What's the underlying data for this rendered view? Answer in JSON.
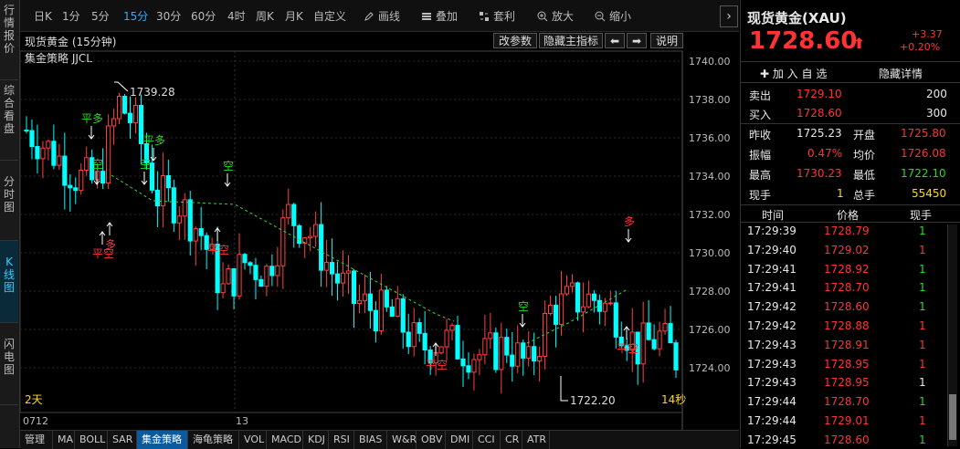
{
  "left_tabs": [
    "行情报价",
    "综合看盘",
    "分时图",
    "K线图",
    "闪电图"
  ],
  "toolbar": {
    "items": [
      "日K",
      "1分",
      "5分",
      "15分",
      "30分",
      "60分",
      "4时",
      "周K",
      "月K",
      "自定义"
    ],
    "active": "15分",
    "draw_label": "画线",
    "overlay_label": "叠加",
    "arbitrage_label": "套利",
    "zoom_in_label": "放大",
    "zoom_out_label": "缩小",
    "collapse_arrow": "›"
  },
  "chart_header": {
    "title": "现货黄金 (15分钟)",
    "strategy": "集金策略 JJCL",
    "btn_params": "改参数",
    "btn_hide": "隐藏主指标",
    "btn_left": "⬅",
    "btn_right": "➡",
    "btn_help": "说明"
  },
  "chart_data": {
    "type": "candlestick",
    "ylim": [
      1721,
      1741
    ],
    "yticks": [
      "1740.00",
      "1738.00",
      "1736.00",
      "1734.00",
      "1732.00",
      "1730.00",
      "1728.00",
      "1726.00",
      "1724.00"
    ],
    "xticks": [
      "0712",
      "13"
    ],
    "bar_count": 120,
    "high_label": "1739.28",
    "low_label": "1722.20",
    "corner_left": "2天",
    "corner_right": "14秒",
    "signals": [
      {
        "text": "平多",
        "type": "green"
      },
      {
        "text": "平多",
        "type": "green"
      },
      {
        "text": "空",
        "type": "green"
      },
      {
        "text": "空",
        "type": "green"
      },
      {
        "text": "空",
        "type": "green"
      },
      {
        "text": "空",
        "type": "green"
      },
      {
        "text": "平空",
        "type": "red"
      },
      {
        "text": "多",
        "type": "red"
      },
      {
        "text": "平空",
        "type": "red"
      },
      {
        "text": "平空",
        "type": "red"
      },
      {
        "text": "多",
        "type": "red"
      },
      {
        "text": "平空",
        "type": "red"
      }
    ]
  },
  "bottom_tabs": [
    "管理",
    "MA",
    "BOLL",
    "SAR",
    "集金策略",
    "海龟策略",
    "VOL",
    "MACD",
    "KDJ",
    "RSI",
    "BIAS",
    "W&R",
    "OBV",
    "DMI",
    "CCI",
    "CR",
    "ATR"
  ],
  "bottom_active": "集金策略",
  "quote": {
    "name": "现货黄金(XAU)",
    "price": "1728.60",
    "arrow": "⬆",
    "change": "+3.37",
    "change_pct": "+0.20%",
    "add_fav": "✚ 加 入 自 选",
    "hide_detail": "隐藏详情",
    "sell_label": "卖出",
    "sell_price": "1729.10",
    "sell_vol": "200",
    "buy_label": "买入",
    "buy_price": "1728.60",
    "buy_vol": "300",
    "prev_close_label": "昨收",
    "prev_close": "1725.23",
    "open_label": "开盘",
    "open": "1725.80",
    "amp_label": "振幅",
    "amp": "0.47%",
    "avg_label": "均价",
    "avg": "1726.08",
    "high_label": "最高",
    "high": "1730.23",
    "low_label": "最低",
    "low": "1722.10",
    "cur_vol_label": "现手",
    "cur_vol": "1",
    "total_label": "总手",
    "total": "55450"
  },
  "ticks_header": {
    "time": "时间",
    "price": "价格",
    "vol": "现手"
  },
  "ticks": [
    {
      "time": "17:29:39",
      "price": "1728.79",
      "vol": "1",
      "c": "green"
    },
    {
      "time": "17:29:40",
      "price": "1729.02",
      "vol": "1",
      "c": "red"
    },
    {
      "time": "17:29:41",
      "price": "1728.92",
      "vol": "1",
      "c": "green"
    },
    {
      "time": "17:29:41",
      "price": "1728.70",
      "vol": "1",
      "c": "green"
    },
    {
      "time": "17:29:42",
      "price": "1728.60",
      "vol": "1",
      "c": "green"
    },
    {
      "time": "17:29:42",
      "price": "1728.88",
      "vol": "1",
      "c": "red"
    },
    {
      "time": "17:29:43",
      "price": "1728.91",
      "vol": "1",
      "c": "red"
    },
    {
      "time": "17:29:43",
      "price": "1728.95",
      "vol": "1",
      "c": "red"
    },
    {
      "time": "17:29:43",
      "price": "1728.95",
      "vol": "1",
      "c": "white"
    },
    {
      "time": "17:29:44",
      "price": "1728.70",
      "vol": "1",
      "c": "green"
    },
    {
      "time": "17:29:44",
      "price": "1729.01",
      "vol": "1",
      "c": "red"
    },
    {
      "time": "17:29:45",
      "price": "1728.60",
      "vol": "1",
      "c": "green"
    }
  ]
}
